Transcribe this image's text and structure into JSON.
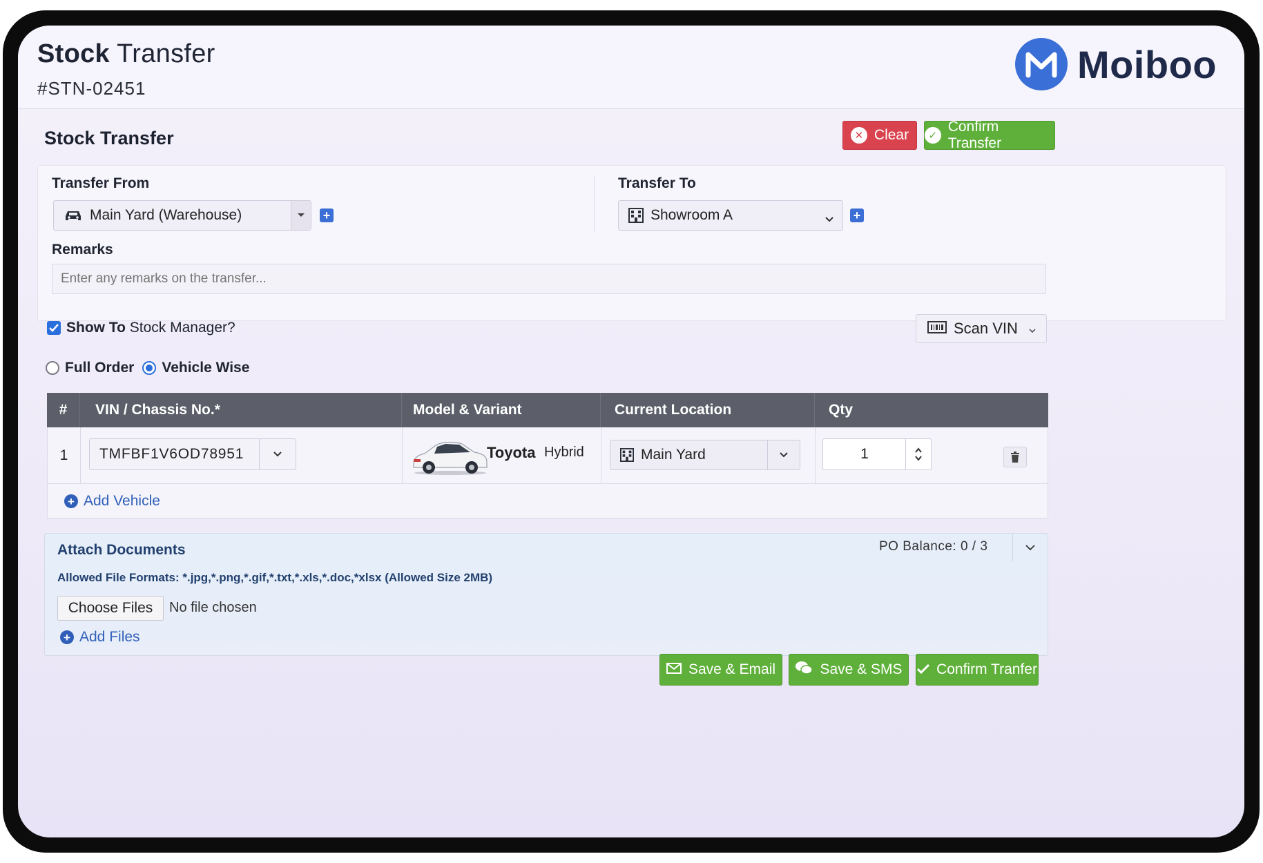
{
  "header": {
    "title_bold": "Stock",
    "title_rest": " Transfer",
    "order_number": "#STN-02451",
    "brand": "Moiboo"
  },
  "panel": {
    "title": "Stock Transfer",
    "clear_label": "Clear",
    "confirm_label": "Confirm Transfer"
  },
  "form": {
    "from_label": "Transfer From",
    "from_value": "Main Yard (Warehouse)",
    "to_label": "Transfer To",
    "to_value": "Showroom A",
    "remarks_label": "Remarks",
    "remarks_placeholder": "Enter any remarks on the transfer..."
  },
  "options": {
    "show_manager_bold": "Show To",
    "show_manager_rest": " Stock Manager?",
    "show_manager_checked": true,
    "scan_label": "Scan VIN",
    "radio_full": "Full Order",
    "radio_vehicle": "Vehicle Wise",
    "selected_mode": "Vehicle Wise"
  },
  "table": {
    "headers": [
      "#",
      "VIN / Chassis No.*",
      "Model & Variant",
      "Current Location",
      "Qty"
    ],
    "rows": [
      {
        "index": "1",
        "vin": "TMFBF1V6OD78951",
        "model": "Toyota",
        "variant": "Hybrid",
        "location": "Main Yard",
        "qty": "1"
      }
    ],
    "add_vehicle_label": "Add Vehicle"
  },
  "attach": {
    "title": "Attach Documents",
    "formats": "Allowed File Formats: *.jpg,*.png,*.gif,*.txt,*.xls,*.doc,*xlsx (Allowed Size 2MB)",
    "choose_label": "Choose Files",
    "no_file": "No file chosen",
    "add_files_label": "Add Files",
    "po_balance": "PO Balance: 0 / 3"
  },
  "footer": {
    "save_email": "Save & Email",
    "save_sms": "Save & SMS",
    "confirm": "Confirm Tranfer"
  },
  "colors": {
    "primary_blue": "#2b6fdc",
    "danger_red": "#d9434e",
    "success_green": "#5fb03a",
    "table_header": "#5c5f69",
    "brand_navy": "#1f2a4a"
  },
  "icons": {
    "from_select": "car-icon",
    "to_select": "building-icon",
    "scan": "barcode-icon",
    "row_delete": "trash-icon"
  }
}
